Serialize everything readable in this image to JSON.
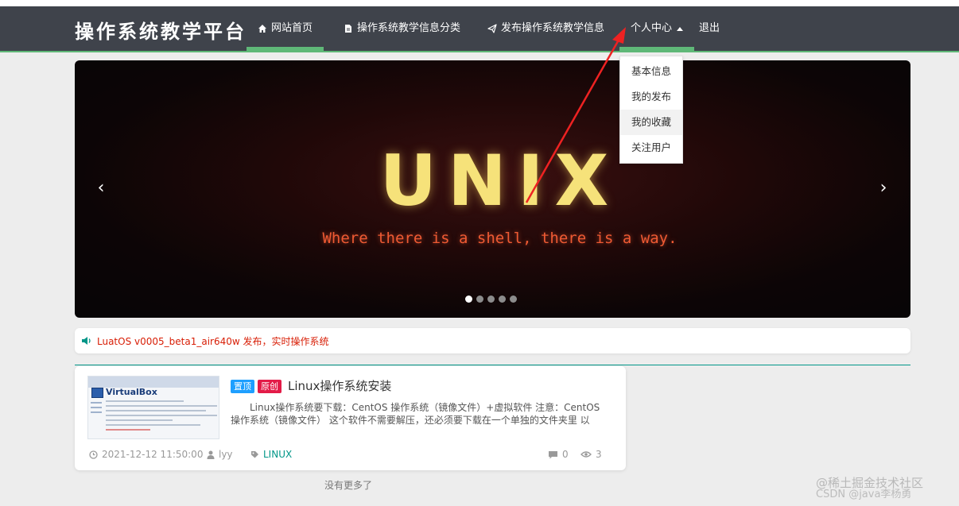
{
  "navbar": {
    "brand": "操作系统教学平台",
    "items": [
      {
        "label": "网站首页",
        "icon": "home-icon",
        "active": true
      },
      {
        "label": "操作系统教学信息分类",
        "icon": "file-icon"
      },
      {
        "label": "发布操作系统教学信息",
        "icon": "paper-plane-icon"
      },
      {
        "label": "个人中心",
        "icon": "caret-up-icon"
      },
      {
        "label": "退出"
      }
    ],
    "accent": "#5fb878",
    "bg": "#3f434b"
  },
  "dropdown": {
    "items": [
      "基本信息",
      "我的发布",
      "我的收藏",
      "关注用户"
    ],
    "hovered": "我的收藏"
  },
  "carousel": {
    "headline": "UNIX",
    "tagline": "Where there is a shell, there is a way.",
    "prev_label": "‹",
    "next_label": "›",
    "slide_count": 5,
    "active_slide": 1
  },
  "notice": {
    "icon": "speaker-icon",
    "text": "LuatOS v0005_beta1_air640w 发布，实时操作系统",
    "color": "#d81e06"
  },
  "post": {
    "thumbnail_text": "VirtualBox",
    "badges": [
      "置顶",
      "原创"
    ],
    "title": "Linux操作系统安装",
    "summary": "Linux操作系统要下载：CentOS 操作系统（镜像文件）+虚拟软件 注意：CentOS 操作系统（镜像文件） 这个软件不需要解压，还必须要下载在一个单独的文件夹里 以",
    "date": "2021-12-12 11:50:00",
    "author": "lyy",
    "tag": "LINUX",
    "comments": "0",
    "views": "3"
  },
  "footer": {
    "no_more": "没有更多了"
  },
  "watermark": {
    "line1": "@稀土掘金技术社区",
    "line2": "CSDN @java李杨勇"
  }
}
